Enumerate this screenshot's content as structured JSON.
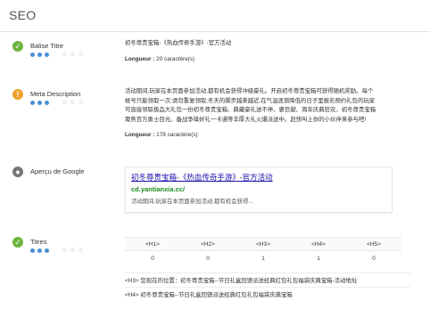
{
  "header": {
    "title": "SEO"
  },
  "balise_titre": {
    "label": "Balise Titre",
    "status": "ok",
    "rating_dots": [
      true,
      true,
      true,
      false,
      false
    ],
    "text": "初冬尊贵宝箱-《热血传奇手游》-官方活动",
    "length_label": "Longueur :",
    "length_value": "20 caractère(s)"
  },
  "meta_description": {
    "label": "Meta Description",
    "status": "warn",
    "rating_dots": [
      true,
      true,
      true,
      false,
      false
    ],
    "lines": [
      "活动期间,玩家在本页面参加活动,都有机会获得冲级豪礼。开启初冬尊贵宝箱可获得随机奖励。每个",
      "帐号只能领取一次;请勿重复领取;冬天的脚步越来越近,在气温逐渐降低的日子里报名预约礼包的玩家",
      "可直接领取极品大礼包一份初冬尊贵宝箱、典藏豪礼送不停、褒巨献、周年庆典狂欢、初冬尊贵宝箱",
      "聚焦百万勇士目光。备战争锋好礼一卡通等丰厚大礼火爆派送中。赶快叫上你的小伙伴来参与吧!"
    ],
    "length_label": "Longueur :",
    "length_value": "178 caractère(s)"
  },
  "google_preview": {
    "label": "Aperçu de Google",
    "status": "info",
    "title": "初冬尊贵宝箱-《热血传奇手游》-官方活动",
    "url": "cd.yantianxia.cc/",
    "desc": "活动期间,玩家在本页面参加活动,都有机会获得..."
  },
  "titres": {
    "label": "Titres",
    "status": "ok",
    "rating_dots": [
      true,
      true,
      true,
      false,
      false
    ],
    "headers": [
      "<H1>",
      "<H2>",
      "<H3>",
      "<H4>",
      "<H5>"
    ],
    "counts": [
      "0",
      "0",
      "1",
      "1",
      "0"
    ],
    "h3_line": "<H3> 您现在的位置：初冬尊贵宝箱--节日礼盒回馈派送经典红包礼包福袋庆典宝箱-活动地址",
    "h4_line": "<H4> 初冬尊贵宝箱--节日礼盒回馈派送经典红包礼包福袋庆典宝箱"
  }
}
